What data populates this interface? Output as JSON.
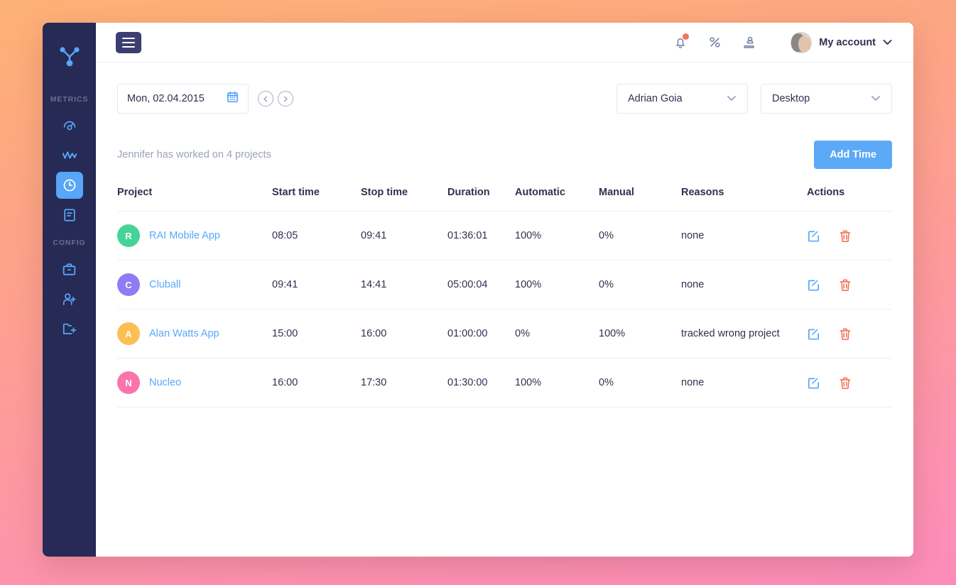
{
  "theme": {
    "bg_gradient_from": "#FDB175",
    "bg_gradient_to": "#FD8CBA",
    "sidebar_bg": "#262A55",
    "accent_blue": "#5CA9F8",
    "danger_red": "#F9705B",
    "text_dark": "#2E3150",
    "text_muted": "#9AA2BB"
  },
  "sidebar": {
    "logo_icon": "network-nodes-icon",
    "sections": [
      {
        "label": "METRICS",
        "items": [
          {
            "name": "dashboard",
            "icon": "gauge-icon",
            "active": false
          },
          {
            "name": "activity",
            "icon": "pulse-wave-icon",
            "active": false
          },
          {
            "name": "time-tracking",
            "icon": "clock-icon",
            "active": true
          },
          {
            "name": "reports",
            "icon": "document-icon",
            "active": false
          }
        ]
      },
      {
        "label": "CONFIG",
        "items": [
          {
            "name": "projects",
            "icon": "briefcase-icon",
            "active": false
          },
          {
            "name": "add-user",
            "icon": "user-plus-icon",
            "active": false
          },
          {
            "name": "add-project",
            "icon": "folder-plus-icon",
            "active": false
          }
        ]
      }
    ]
  },
  "topbar": {
    "menu_icon": "hamburger-icon",
    "icons": [
      {
        "name": "notifications-icon",
        "has_badge": true
      },
      {
        "name": "percent-icon",
        "has_badge": false
      },
      {
        "name": "team-icon",
        "has_badge": false
      }
    ],
    "account_label": "My account",
    "account_chevron": "chevron-down-icon"
  },
  "controls": {
    "date_value": "Mon, 02.04.2015",
    "calendar_icon": "calendar-icon",
    "prev_icon": "chevron-left-circle-icon",
    "next_icon": "chevron-right-circle-icon",
    "person_select": {
      "value": "Adrian Goia",
      "chevron": "chevron-down-icon"
    },
    "device_select": {
      "value": "Desktop",
      "chevron": "chevron-down-icon"
    }
  },
  "summary": {
    "text": "Jennifer has worked on 4 projects",
    "add_time_label": "Add Time"
  },
  "table": {
    "headers": {
      "project": "Project",
      "start": "Start time",
      "stop": "Stop time",
      "duration": "Duration",
      "automatic": "Automatic",
      "manual": "Manual",
      "reasons": "Reasons",
      "actions": "Actions"
    },
    "rows": [
      {
        "initial": "R",
        "avatar_color": "#46D399",
        "project": "RAI Mobile App",
        "start": "08:05",
        "stop": "09:41",
        "duration": "01:36:01",
        "automatic": "100%",
        "manual": "0%",
        "reason": "none",
        "reason_empty": true
      },
      {
        "initial": "C",
        "avatar_color": "#8E7CF5",
        "project": "Cluball",
        "start": "09:41",
        "stop": "14:41",
        "duration": "05:00:04",
        "automatic": "100%",
        "manual": "0%",
        "reason": "none",
        "reason_empty": true
      },
      {
        "initial": "A",
        "avatar_color": "#FBBF54",
        "project": "Alan Watts App",
        "start": "15:00",
        "stop": "16:00",
        "duration": "01:00:00",
        "automatic": "0%",
        "manual": "100%",
        "reason": "tracked wrong project",
        "reason_empty": false
      },
      {
        "initial": "N",
        "avatar_color": "#FA74AC",
        "project": "Nucleo",
        "start": "16:00",
        "stop": "17:30",
        "duration": "01:30:00",
        "automatic": "100%",
        "manual": "0%",
        "reason": "none",
        "reason_empty": true
      }
    ],
    "row_actions": {
      "edit_icon": "edit-pencil-icon",
      "delete_icon": "trash-icon"
    }
  }
}
